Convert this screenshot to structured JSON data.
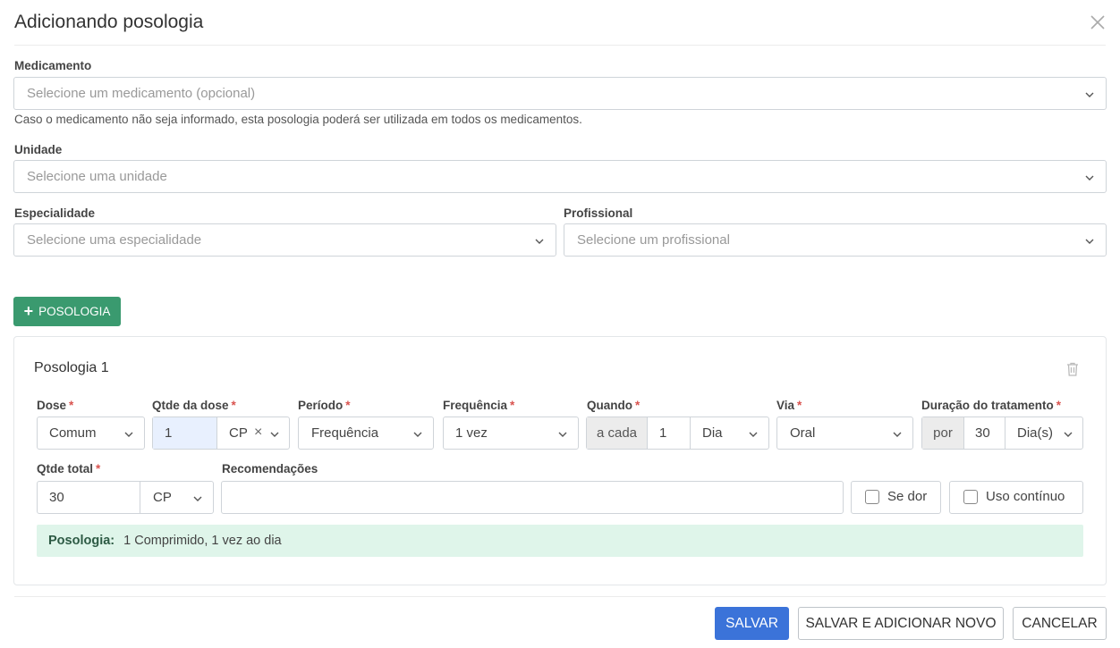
{
  "header": {
    "title": "Adicionando posologia"
  },
  "medicamento": {
    "label": "Medicamento",
    "placeholder": "Selecione um medicamento (opcional)",
    "hint": "Caso o medicamento não seja informado, esta posologia poderá ser utilizada em todos os medicamentos."
  },
  "unidade": {
    "label": "Unidade",
    "placeholder": "Selecione uma unidade"
  },
  "especialidade": {
    "label": "Especialidade",
    "placeholder": "Selecione uma especialidade"
  },
  "profissional": {
    "label": "Profissional",
    "placeholder": "Selecione um profissional"
  },
  "add_posologia_button": {
    "icon": "+",
    "label": "POSOLOGIA",
    "color": "#3a9a6f"
  },
  "posologia": {
    "title": "Posologia 1",
    "required_mark": "*",
    "dose": {
      "label": "Dose",
      "value": "Comum"
    },
    "qtde_dose": {
      "label": "Qtde da dose",
      "value": "1",
      "unit": "CP",
      "clear": "×"
    },
    "periodo": {
      "label": "Período",
      "value": "Frequência"
    },
    "frequencia": {
      "label": "Frequência",
      "value": "1 vez"
    },
    "quando": {
      "label": "Quando",
      "prefix": "a cada",
      "value": "1",
      "unit": "Dia"
    },
    "via": {
      "label": "Via",
      "value": "Oral"
    },
    "duracao": {
      "label": "Duração do tratamento",
      "prefix": "por",
      "value": "30",
      "unit": "Dia(s)"
    },
    "qtde_total": {
      "label": "Qtde total",
      "value": "30",
      "unit": "CP"
    },
    "recomendacoes": {
      "label": "Recomendações",
      "value": ""
    },
    "se_dor": {
      "label": "Se dor",
      "checked": false
    },
    "uso_continuo": {
      "label": "Uso contínuo",
      "checked": false
    },
    "summary": {
      "label": "Posologia:",
      "text": "1 Comprimido, 1 vez ao dia",
      "background": "#dff5ea"
    }
  },
  "footer": {
    "save": "SALVAR",
    "save_and_new": "SALVAR E ADICIONAR NOVO",
    "cancel": "CANCELAR",
    "primary_color": "#3b73d9"
  }
}
